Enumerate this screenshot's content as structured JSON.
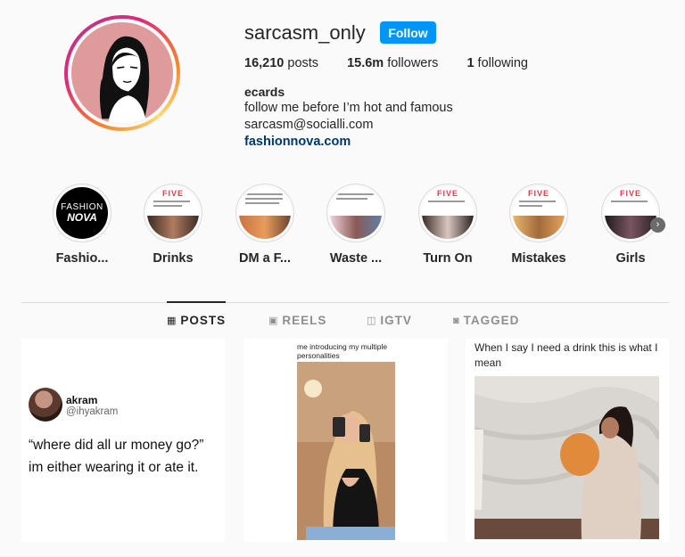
{
  "profile": {
    "username": "sarcasm_only",
    "follow_label": "Follow",
    "posts_count": "16,210",
    "posts_label": "posts",
    "followers_count": "15.6m",
    "followers_label": "followers",
    "following_count": "1",
    "following_label": "following",
    "bio_name": "ecards",
    "bio_lines": [
      "follow me before I’m hot and famous",
      "sarcasm@socialli.com"
    ],
    "link": "fashionnova.com"
  },
  "highlights": [
    {
      "label": "Fashio...",
      "thumb_text": [
        "FASHION",
        "NOVA"
      ]
    },
    {
      "label": "Drinks",
      "thumb_text": [
        "FIVE"
      ]
    },
    {
      "label": "DM a F...",
      "thumb_text": []
    },
    {
      "label": "Waste ...",
      "thumb_text": []
    },
    {
      "label": "Turn On",
      "thumb_text": [
        "FIVE"
      ]
    },
    {
      "label": "Mistakes",
      "thumb_text": [
        "FIVE"
      ]
    },
    {
      "label": "Girls",
      "thumb_text": [
        "FIVE"
      ]
    }
  ],
  "tabs": [
    {
      "label": "POSTS",
      "icon": "grid-icon",
      "glyph": "▦",
      "active": true
    },
    {
      "label": "REELS",
      "icon": "reels-icon",
      "glyph": "▣",
      "active": false
    },
    {
      "label": "IGTV",
      "icon": "igtv-icon",
      "glyph": "◫",
      "active": false
    },
    {
      "label": "TAGGED",
      "icon": "tagged-icon",
      "glyph": "◙",
      "active": false
    }
  ],
  "posts": [
    {
      "tweet_name": "akram",
      "tweet_handle": "@ihyakram",
      "tweet_text": "“where did all ur money go?” im either wearing it or ate it."
    },
    {
      "caption": "me introducing my multiple personalities"
    },
    {
      "caption": "When I say I need a drink this is what I mean"
    }
  ],
  "colors": {
    "follow_button": "#0095f6",
    "link": "#00376b",
    "avatar_bg": "#df9a9c"
  }
}
